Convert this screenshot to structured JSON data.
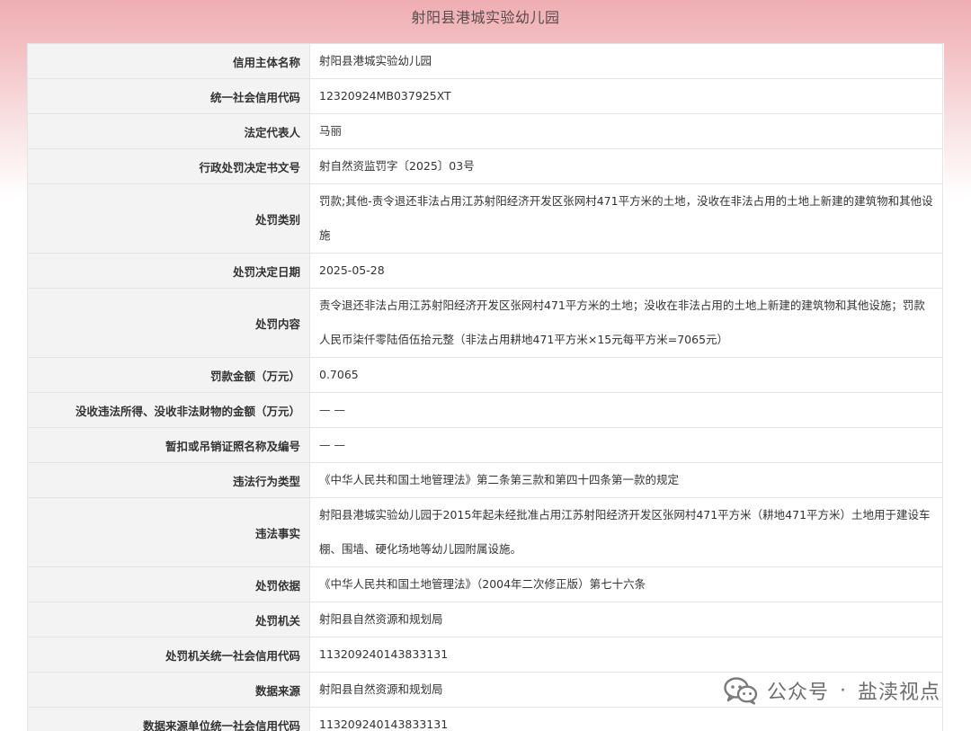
{
  "header": {
    "title": "射阳县港城实验幼儿园"
  },
  "rows": [
    {
      "label": "信用主体名称",
      "value": "射阳县港城实验幼儿园"
    },
    {
      "label": "统一社会信用代码",
      "value": "12320924MB037925XT"
    },
    {
      "label": "法定代表人",
      "value": "马丽"
    },
    {
      "label": "行政处罚决定书文号",
      "value": "射自然资监罚字〔2025〕03号"
    },
    {
      "label": "处罚类别",
      "value": "罚款;其他-责令退还非法占用江苏射阳经济开发区张网村471平方米的土地，没收在非法占用的土地上新建的建筑物和其他设施"
    },
    {
      "label": "处罚决定日期",
      "value": "2025-05-28"
    },
    {
      "label": "处罚内容",
      "value": "责令退还非法占用江苏射阳经济开发区张网村471平方米的土地；没收在非法占用的土地上新建的建筑物和其他设施；罚款人民币柒仟零陆佰伍拾元整（非法占用耕地471平方米×15元每平方米=7065元）"
    },
    {
      "label": "罚款金额（万元）",
      "value": "0.7065"
    },
    {
      "label": "没收违法所得、没收非法财物的金额（万元）",
      "value": "— —"
    },
    {
      "label": "暂扣或吊销证照名称及编号",
      "value": "— —"
    },
    {
      "label": "违法行为类型",
      "value": "《中华人民共和国土地管理法》第二条第三款和第四十四条第一款的规定"
    },
    {
      "label": "违法事实",
      "value": "射阳县港城实验幼儿园于2015年起未经批准占用江苏射阳经济开发区张网村471平方米（耕地471平方米）土地用于建设车棚、围墙、硬化场地等幼儿园附属设施。"
    },
    {
      "label": "处罚依据",
      "value": "《中华人民共和国土地管理法》（2004年二次修正版）第七十六条"
    },
    {
      "label": "处罚机关",
      "value": "射阳县自然资源和规划局"
    },
    {
      "label": "处罚机关统一社会信用代码",
      "value": "113209240143833131"
    },
    {
      "label": "数据来源",
      "value": "射阳县自然资源和规划局"
    },
    {
      "label": "数据来源单位统一社会信用代码",
      "value": "113209240143833131"
    }
  ],
  "watermark": {
    "logo_icon": "wechat-logo-icon",
    "prefix": "公众号",
    "separator": "·",
    "account": "盐渎视点"
  }
}
